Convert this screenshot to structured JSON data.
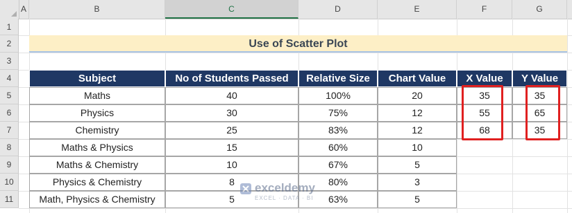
{
  "columns": [
    "A",
    "B",
    "C",
    "D",
    "E",
    "F",
    "G"
  ],
  "rows": [
    "1",
    "2",
    "3",
    "4",
    "5",
    "6",
    "7",
    "8",
    "9",
    "10",
    "11"
  ],
  "title": "Use of Scatter Plot",
  "main_table": {
    "headers": [
      "Subject",
      "No of Students Passed",
      "Relative Size",
      "Chart Value"
    ],
    "rows": [
      [
        "Maths",
        "40",
        "100%",
        "20"
      ],
      [
        "Physics",
        "30",
        "75%",
        "12"
      ],
      [
        "Chemistry",
        "25",
        "83%",
        "12"
      ],
      [
        "Maths & Physics",
        "15",
        "60%",
        "10"
      ],
      [
        "Maths & Chemistry",
        "10",
        "67%",
        "5"
      ],
      [
        "Physics & Chemistry",
        "8",
        "80%",
        "3"
      ],
      [
        "Math, Physics & Chemistry",
        "5",
        "63%",
        "5"
      ]
    ]
  },
  "xy_table": {
    "headers": [
      "X Value",
      "Y Value"
    ],
    "rows": [
      [
        "35",
        "35"
      ],
      [
        "55",
        "65"
      ],
      [
        "68",
        "35"
      ]
    ]
  },
  "watermark": {
    "name": "exceldemy",
    "tagline": "EXCEL · DATA · BI"
  },
  "colors": {
    "header_bg": "#1f3864",
    "title_bg": "#fdefc6",
    "highlight": "#e02020",
    "selected_col": "#217346"
  }
}
